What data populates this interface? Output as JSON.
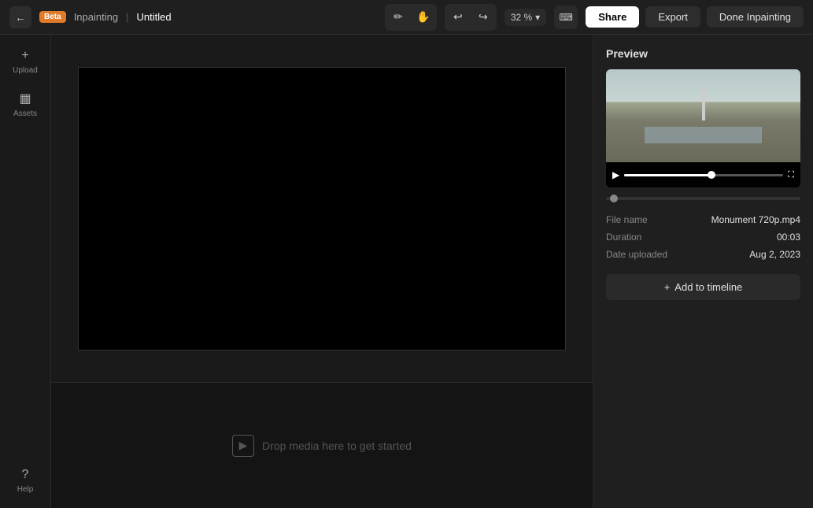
{
  "topbar": {
    "back_label": "←",
    "beta_label": "Beta",
    "project_name": "Inpainting",
    "separator": "|",
    "doc_title": "Untitled",
    "tools": {
      "draw_icon": "✏",
      "hand_icon": "✋",
      "undo_icon": "↩",
      "redo_icon": "↪",
      "zoom_value": "32 %",
      "zoom_arrow": "▾",
      "keyboard_icon": "⌨"
    },
    "share_label": "Share",
    "export_label": "Export",
    "done_label": "Done Inpainting"
  },
  "sidebar": {
    "upload_icon": "+",
    "upload_label": "Upload",
    "assets_icon": "▦",
    "assets_label": "Assets",
    "help_icon": "?",
    "help_label": "Help"
  },
  "canvas": {
    "background": "#000000"
  },
  "timeline": {
    "drop_hint": "Drop media here to get started",
    "drop_icon": "▶"
  },
  "preview": {
    "title": "Preview",
    "play_icon": "▶",
    "fullscreen_icon": "⛶",
    "file_name_key": "File name",
    "file_name_val": "Monument 720p.mp4",
    "duration_key": "Duration",
    "duration_val": "00:03",
    "date_key": "Date uploaded",
    "date_val": "Aug 2, 2023",
    "add_timeline_icon": "+",
    "add_timeline_label": "Add to timeline"
  },
  "colors": {
    "accent": "#e07b2a",
    "bg_main": "#1a1a1a",
    "bg_panel": "#1f1f1f",
    "border": "#2a2a2a",
    "text_primary": "#e0e0e0",
    "text_secondary": "#888888"
  }
}
